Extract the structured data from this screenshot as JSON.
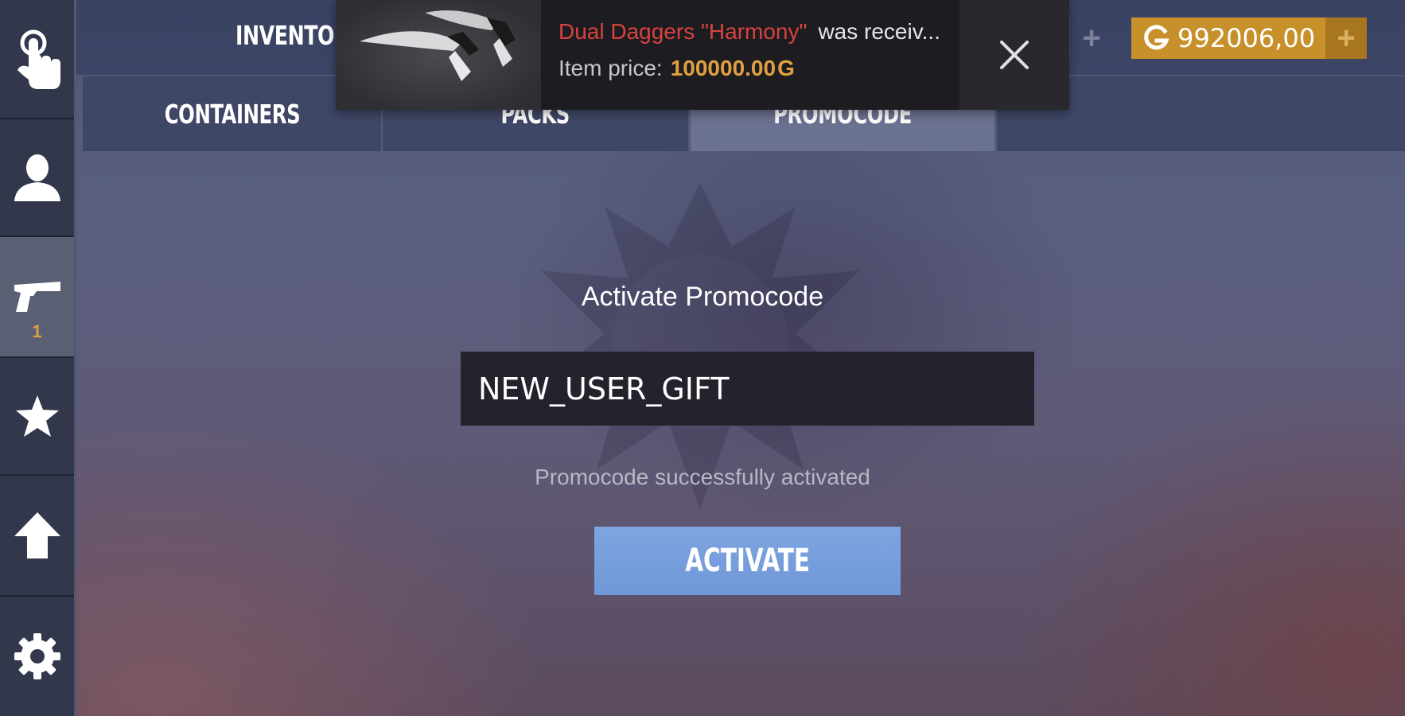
{
  "header": {
    "title": "INVENTORY",
    "currency_amount": "992006,00",
    "colors": {
      "currency_bg": "#c8902b",
      "accent_blue": "#7fa5e0",
      "alert_red": "#d8433f"
    }
  },
  "sidebar": {
    "items": [
      {
        "icon": "hand-pointer-icon"
      },
      {
        "icon": "profile-icon"
      },
      {
        "icon": "pistol-icon",
        "count": "1",
        "active": true
      },
      {
        "icon": "star-icon"
      },
      {
        "icon": "arrow-up-icon"
      },
      {
        "icon": "gear-icon"
      }
    ]
  },
  "tabs": [
    {
      "label": "CONTAINERS"
    },
    {
      "label": "PACKS"
    },
    {
      "label": "PROMOCODE",
      "active": true
    }
  ],
  "notification": {
    "item_name": "Dual Daggers \"Harmony\"",
    "message": "was receiv...",
    "price_label": "Item price:",
    "price_value": "100000.00",
    "currency_symbol": "G"
  },
  "promo": {
    "title": "Activate Promocode",
    "input_value": "NEW_USER_GIFT",
    "status": "Promocode successfully activated",
    "button_label": "ACTIVATE"
  }
}
